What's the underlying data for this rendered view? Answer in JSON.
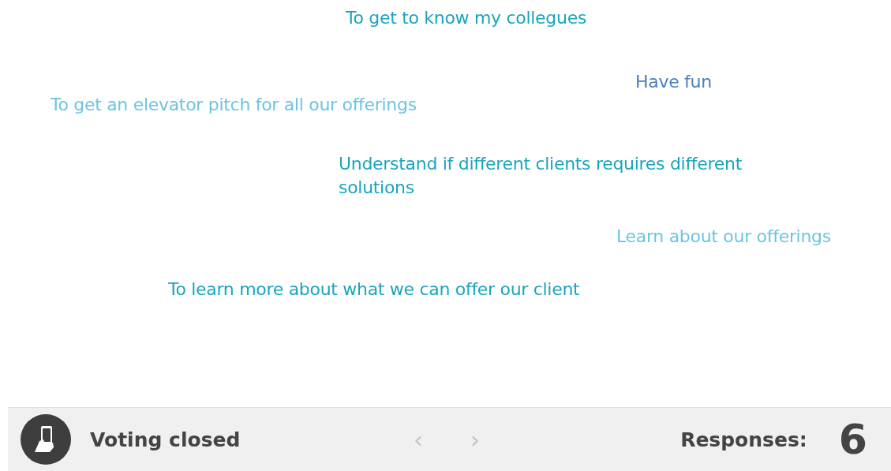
{
  "responses": [
    {
      "text": "To get to know my collegues",
      "color": "#1aa5bd"
    },
    {
      "text": "Have fun",
      "color": "#4f80b6"
    },
    {
      "text": "To get an elevator pitch for all our offerings",
      "color": "#6cc4e2"
    },
    {
      "text": "Understand if different clients requires different solutions",
      "color": "#1aa5bd"
    },
    {
      "text": "Learn about our offerings",
      "color": "#6cc4e2"
    },
    {
      "text": "To learn more about what we can offer our client",
      "color": "#1aa5bd"
    }
  ],
  "footer": {
    "status": "Voting closed",
    "prev": {
      "label": "‹",
      "disabled": true
    },
    "next": {
      "label": "›",
      "disabled": true
    },
    "responses_label": "Responses:",
    "responses_count": "6"
  }
}
